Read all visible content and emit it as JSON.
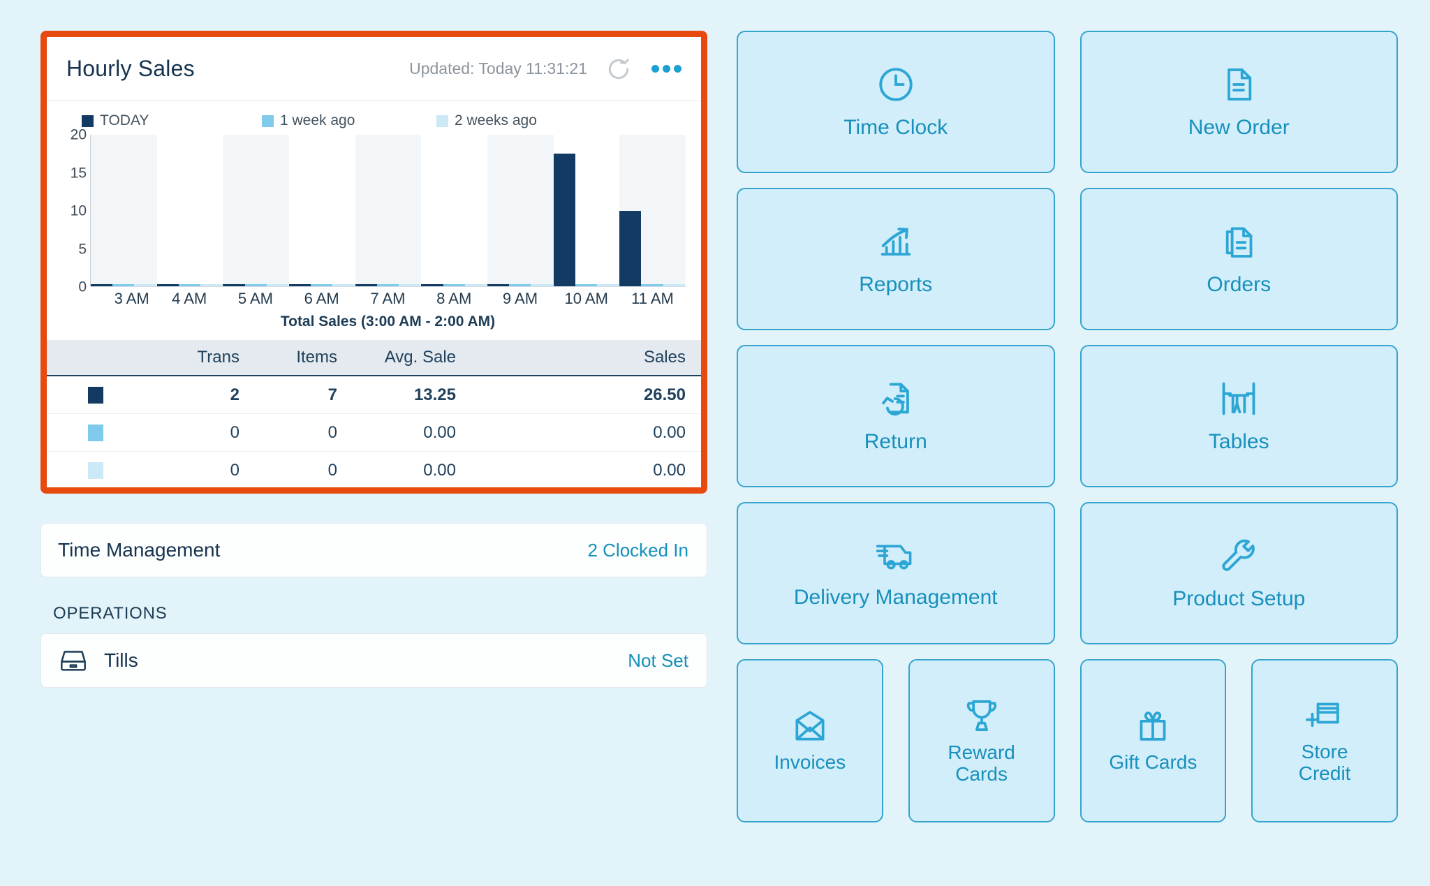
{
  "card": {
    "title": "Hourly Sales",
    "updated": "Updated: Today 11:31:21",
    "refresh_icon": "refresh-icon",
    "menu_icon": "more-options-icon"
  },
  "chart_data": {
    "type": "bar",
    "title": "Hourly Sales",
    "caption": "Total Sales (3:00 AM - 2:00 AM)",
    "xlabel": "",
    "ylabel": "",
    "ylim": [
      0,
      20
    ],
    "yticks": [
      20,
      15,
      10,
      5,
      0
    ],
    "grid": false,
    "legend_position": "top-left",
    "categories": [
      "3 AM",
      "4 AM",
      "5 AM",
      "6 AM",
      "7 AM",
      "8 AM",
      "9 AM",
      "10 AM",
      "11 AM"
    ],
    "series": [
      {
        "name": "TODAY",
        "color": "#123a63",
        "values": [
          0,
          0,
          0,
          0,
          0,
          0,
          0,
          17.5,
          10
        ]
      },
      {
        "name": "1 week ago",
        "color": "#80cbeb",
        "values": [
          0,
          0,
          0,
          0,
          0,
          0,
          0,
          0,
          0
        ]
      },
      {
        "name": "2 weeks ago",
        "color": "#cbe9f7",
        "values": [
          0,
          0,
          0,
          0,
          0,
          0,
          0,
          0,
          0
        ]
      }
    ]
  },
  "table": {
    "headers": [
      "",
      "Trans",
      "Items",
      "Avg. Sale",
      "Sales"
    ],
    "rows": [
      {
        "swatch": "#123a63",
        "trans": "2",
        "items": "7",
        "avg": "13.25",
        "sales": "26.50"
      },
      {
        "swatch": "#80cbeb",
        "trans": "0",
        "items": "0",
        "avg": "0.00",
        "sales": "0.00"
      },
      {
        "swatch": "#cbe9f7",
        "trans": "0",
        "items": "0",
        "avg": "0.00",
        "sales": "0.00"
      }
    ]
  },
  "time_management": {
    "title": "Time Management",
    "value": "2 Clocked In"
  },
  "operations": {
    "label": "OPERATIONS",
    "items": [
      {
        "icon": "till-drawer-icon",
        "label": "Tills",
        "value": "Not Set"
      }
    ]
  },
  "tiles": {
    "rows": [
      [
        {
          "label": "Time Clock",
          "icon": "clock-icon"
        },
        {
          "label": "New Order",
          "icon": "document-lines-icon"
        }
      ],
      [
        {
          "label": "Reports",
          "icon": "bar-chart-arrow-icon"
        },
        {
          "label": "Orders",
          "icon": "stacked-documents-icon"
        }
      ],
      [
        {
          "label": "Return",
          "icon": "document-undo-icon"
        },
        {
          "label": "Tables",
          "icon": "table-chairs-icon"
        }
      ],
      [
        {
          "label": "Delivery Management",
          "icon": "delivery-truck-icon"
        },
        {
          "label": "Product Setup",
          "icon": "wrench-icon"
        }
      ],
      [
        {
          "label": "Invoices",
          "icon": "envelope-icon"
        },
        {
          "label": "Reward\nCards",
          "icon": "trophy-icon"
        },
        {
          "label": "Gift Cards",
          "icon": "gift-icon"
        },
        {
          "label": "Store\nCredit",
          "icon": "credit-card-plus-icon"
        }
      ]
    ]
  },
  "colors": {
    "highlight": "#e8490f",
    "accent": "#1790bb",
    "tile_bg": "#d3eefb",
    "tile_border": "#36a4cc",
    "page_bg": "#e2f4fa",
    "today": "#123a63",
    "week1": "#80cbeb",
    "week2": "#cbe9f7"
  }
}
